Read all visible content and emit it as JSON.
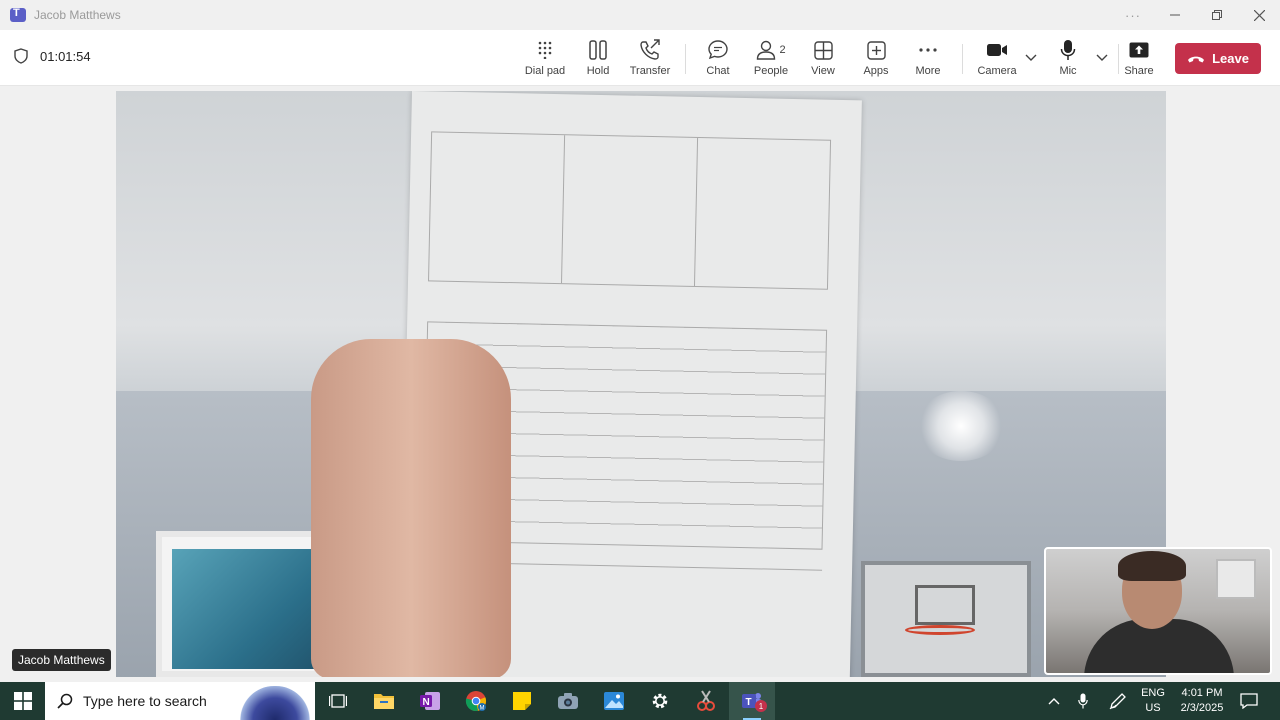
{
  "window": {
    "title": "Jacob Matthews"
  },
  "toolbar": {
    "timer": "01:01:54",
    "dial_pad": "Dial pad",
    "hold": "Hold",
    "transfer": "Transfer",
    "chat": "Chat",
    "people": "People",
    "people_count": "2",
    "view": "View",
    "apps": "Apps",
    "more": "More",
    "camera": "Camera",
    "mic": "Mic",
    "share": "Share",
    "leave": "Leave"
  },
  "stage": {
    "participant_name": "Jacob Matthews"
  },
  "taskbar": {
    "search_placeholder": "Type here to search",
    "teams_badge": "1",
    "language_top": "ENG",
    "language_bottom": "US",
    "time": "4:01 PM",
    "date": "2/3/2025"
  },
  "colors": {
    "leave_red": "#c4314b",
    "taskbar_bg": "#1f3a32",
    "teams_purple": "#5b5fc7"
  }
}
